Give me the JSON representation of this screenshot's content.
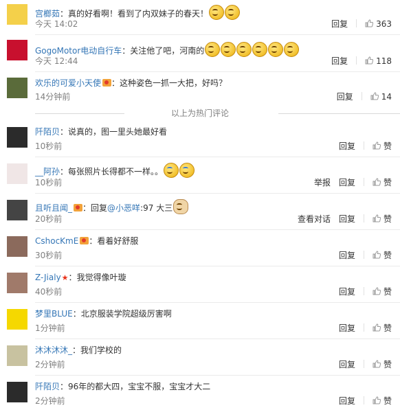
{
  "hot_comments": [
    {
      "user": "宫榔茹",
      "badge": "",
      "text": "真的好看啊！看到了内双妹子的春天！",
      "emojis": [
        "smile",
        "smile"
      ],
      "time": "今天 14:02",
      "actions": [
        "回复"
      ],
      "likes": "363",
      "avatar_color": "#f4d04a"
    },
    {
      "user": "GogoMotor电动自行车",
      "badge": "",
      "text": "关注他了吧，河南的",
      "emojis": [
        "smile",
        "smile",
        "smile",
        "smile",
        "smile",
        "smile"
      ],
      "time": "今天 12:44",
      "actions": [
        "回复"
      ],
      "likes": "118",
      "avatar_color": "#c8102e"
    },
    {
      "user": "欢乐的可爱小天使",
      "badge": "vip",
      "text": "这种姿色一抓一大把，好吗？",
      "emojis": [],
      "time": "14分钟前",
      "actions": [
        "回复"
      ],
      "likes": "14",
      "avatar_color": "#5a6b3a"
    }
  ],
  "hot_footer": "以上为热门评论",
  "comments": [
    {
      "user": "阡陌贝",
      "badge": "",
      "text": "说真的，图一里头她最好看",
      "mention": "",
      "tail": "",
      "emojis": [],
      "time": "10秒前",
      "actions": [
        "回复"
      ],
      "likes": "赞",
      "avatar_color": "#2b2b2b"
    },
    {
      "user": "__阿孙",
      "badge": "",
      "text": "每张照片长得都不一样。。",
      "mention": "",
      "tail": "",
      "emojis": [
        "cry",
        "cry"
      ],
      "time": "10秒前",
      "actions": [
        "举报",
        "回复"
      ],
      "likes": "赞",
      "avatar_color": "#f0e6e6"
    },
    {
      "user": "且听且闻_",
      "badge": "vip",
      "text": "回复",
      "mention": "@小恶咩",
      "tail": ":97 大三",
      "emojis": [
        "dog"
      ],
      "time": "20秒前",
      "actions": [
        "查看对话",
        "回复"
      ],
      "likes": "赞",
      "avatar_color": "#444444"
    },
    {
      "user": "CshocKmE",
      "badge": "vip",
      "text": "看着好舒服",
      "mention": "",
      "tail": "",
      "emojis": [],
      "time": "30秒前",
      "actions": [
        "回复"
      ],
      "likes": "赞",
      "avatar_color": "#8b6a5c"
    },
    {
      "user": "Z-Jialy",
      "badge": "star",
      "text": "我觉得像叶璇",
      "mention": "",
      "tail": "",
      "emojis": [],
      "time": "40秒前",
      "actions": [
        "回复"
      ],
      "likes": "赞",
      "avatar_color": "#a07a6a"
    },
    {
      "user": "梦里BLUE",
      "badge": "",
      "text": "北京服装学院超级厉害啊",
      "mention": "",
      "tail": "",
      "emojis": [],
      "time": "1分钟前",
      "actions": [
        "回复"
      ],
      "likes": "赞",
      "avatar_color": "#f5d800"
    },
    {
      "user": "沐沐沐沐_",
      "badge": "",
      "text": "我们学校的",
      "mention": "",
      "tail": "",
      "emojis": [],
      "time": "2分钟前",
      "actions": [
        "回复"
      ],
      "likes": "赞",
      "avatar_color": "#c8c2a0"
    },
    {
      "user": "阡陌贝",
      "badge": "",
      "text": "96年的都大四，宝宝不服，宝宝才大二",
      "mention": "",
      "tail": "",
      "emojis": [],
      "time": "2分钟前",
      "actions": [
        "回复"
      ],
      "likes": "赞",
      "avatar_color": "#2b2b2b"
    }
  ],
  "colors": {
    "link": "#3476b6",
    "muted": "#808080",
    "text": "#333333"
  }
}
